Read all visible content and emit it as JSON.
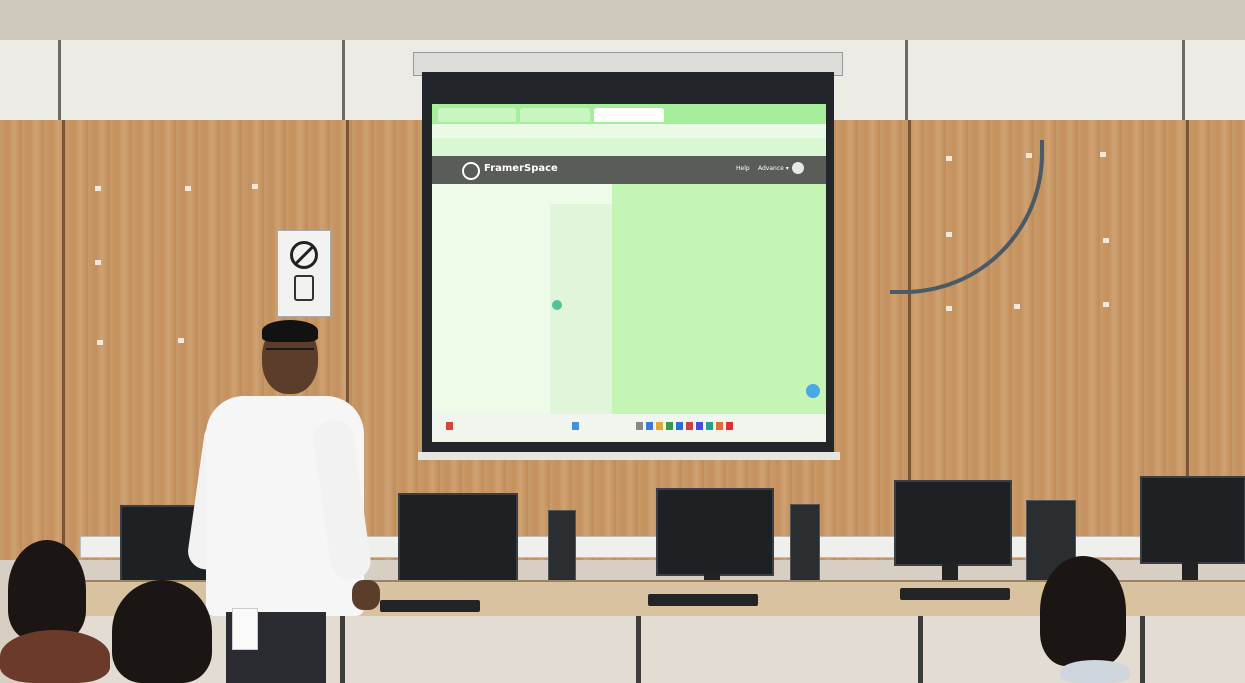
{
  "scene": {
    "description_kind": "photo",
    "colors": {
      "wall_wood": "#c99a6a",
      "projected_green": "#c5f5b4",
      "shirt": "#f6f6f6"
    }
  },
  "projection": {
    "app_brand": "FramerSpace",
    "nav_help": "Help",
    "nav_advance": "Advance ▾"
  },
  "sign": {
    "icon": "no-entry-icon"
  }
}
